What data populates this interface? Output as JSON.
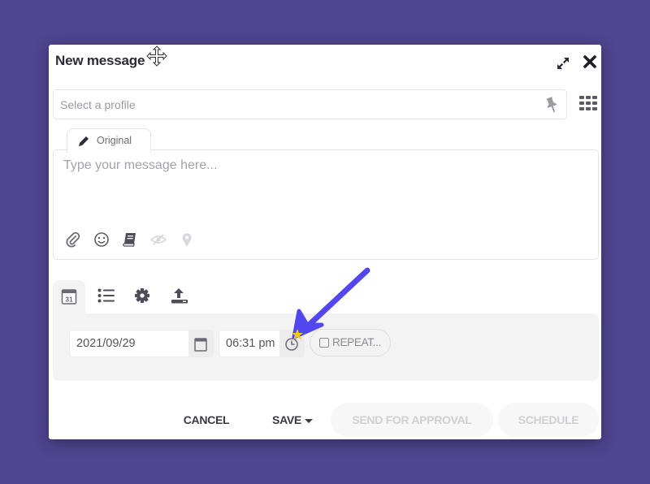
{
  "dialog": {
    "title": "New message"
  },
  "profile": {
    "placeholder": "Select a profile"
  },
  "editor": {
    "tab_label": "Original",
    "message_placeholder": "Type your message here...",
    "message_value": "",
    "tool_icons": [
      "paperclip-icon",
      "smiley-icon",
      "book-icon",
      "eye-slash-icon",
      "map-pin-icon"
    ]
  },
  "subtabs": [
    {
      "name": "calendar-icon",
      "active": true
    },
    {
      "name": "list-icon",
      "active": false
    },
    {
      "name": "gear-icon",
      "active": false
    },
    {
      "name": "upload-icon",
      "active": false
    }
  ],
  "schedule": {
    "date_value": "2021/09/29",
    "time_value": "06:31 pm",
    "repeat_label": "REPEAT...",
    "repeat_checked": false
  },
  "footer": {
    "cancel_label": "CANCEL",
    "save_label": "SAVE",
    "send_approval_label": "SEND FOR APPROVAL",
    "schedule_label": "SCHEDULE"
  },
  "colors": {
    "background": "#4f4590",
    "annotation_arrow": "#5146f0",
    "annotation_star": "#f5c518"
  }
}
